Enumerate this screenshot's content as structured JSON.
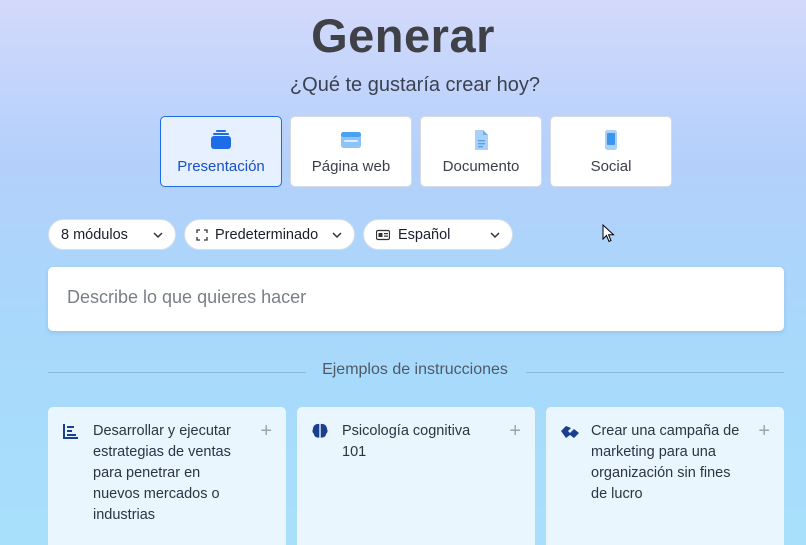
{
  "page": {
    "title": "Generar",
    "subtitle": "¿Qué te gustaría crear hoy?"
  },
  "content_types": [
    {
      "label": "Presentación",
      "icon": "presentation-icon",
      "selected": true
    },
    {
      "label": "Página web",
      "icon": "webpage-icon",
      "selected": false
    },
    {
      "label": "Documento",
      "icon": "document-icon",
      "selected": false
    },
    {
      "label": "Social",
      "icon": "phone-icon",
      "selected": false
    }
  ],
  "options": {
    "modules": "8 módulos",
    "format": "Predeterminado",
    "language": "Español"
  },
  "prompt": {
    "placeholder": "Describe lo que quieres hacer",
    "value": ""
  },
  "examples": {
    "heading": "Ejemplos de instrucciones",
    "items": [
      {
        "text": "Desarrollar y ejecutar estrategias de ventas para penetrar en nuevos mercados o industrias",
        "icon": "bar-chart-icon"
      },
      {
        "text": "Psicología cognitiva 101",
        "icon": "brain-icon"
      },
      {
        "text": "Crear una campaña de marketing para una organización sin fines de lucro",
        "icon": "handshake-icon"
      }
    ]
  },
  "colors": {
    "accent": "#1e6ce6",
    "icon_blue": "#1750c4",
    "active_card_bg": "#e7f0fe"
  }
}
